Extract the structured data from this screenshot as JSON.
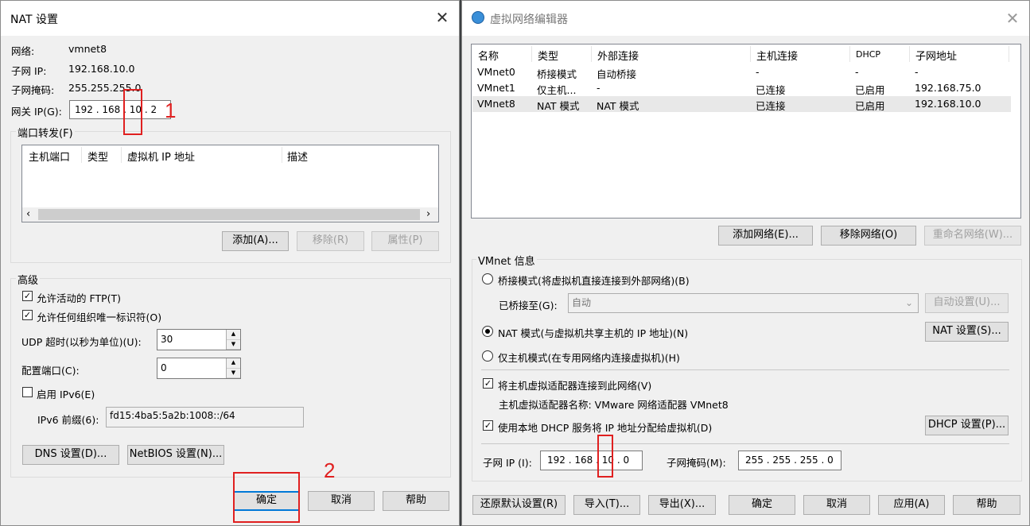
{
  "nat": {
    "title": "NAT 设置",
    "network_label": "网络:",
    "network_value": "vmnet8",
    "subnet_ip_label": "子网 IP:",
    "subnet_ip_value": "192.168.10.0",
    "subnet_mask_label": "子网掩码:",
    "subnet_mask_value": "255.255.255.0",
    "gateway_label": "网关 IP(G):",
    "gateway_octets": [
      "192",
      "168",
      "10",
      "2"
    ],
    "port_forward_label": "端口转发(F)",
    "pf_columns": [
      "主机端口",
      "类型",
      "虚拟机 IP 地址",
      "描述"
    ],
    "add_label": "添加(A)...",
    "remove_label": "移除(R)",
    "props_label": "属性(P)",
    "advanced_label": "高级",
    "allow_ftp_label": "允许活动的 FTP(T)",
    "allow_ftp_checked": true,
    "allow_org_label": "允许任何组织唯一标识符(O)",
    "allow_org_checked": true,
    "udp_label": "UDP 超时(以秒为单位)(U):",
    "udp_value": "30",
    "config_port_label": "配置端口(C):",
    "config_port_value": "0",
    "ipv6_label": "启用 IPv6(E)",
    "ipv6_checked": false,
    "ipv6_prefix_label": "IPv6 前缀(6):",
    "ipv6_prefix_value": "fd15:4ba5:5a2b:1008::/64",
    "dns_label": "DNS 设置(D)...",
    "netbios_label": "NetBIOS 设置(N)...",
    "ok_label": "确定",
    "cancel_label": "取消",
    "help_label": "帮助"
  },
  "vne": {
    "title": "虚拟网络编辑器",
    "columns": [
      "名称",
      "类型",
      "外部连接",
      "主机连接",
      "DHCP",
      "子网地址"
    ],
    "rows": [
      {
        "name": "VMnet0",
        "type": "桥接模式",
        "ext": "自动桥接",
        "host": "-",
        "dhcp": "-",
        "subnet": "-"
      },
      {
        "name": "VMnet1",
        "type": "仅主机...",
        "ext": "-",
        "host": "已连接",
        "dhcp": "已启用",
        "subnet": "192.168.75.0"
      },
      {
        "name": "VMnet8",
        "type": "NAT 模式",
        "ext": "NAT 模式",
        "host": "已连接",
        "dhcp": "已启用",
        "subnet": "192.168.10.0"
      }
    ],
    "add_network": "添加网络(E)...",
    "remove_network": "移除网络(O)",
    "rename_network": "重命名网络(W)...",
    "info_label": "VMnet 信息",
    "bridge_mode": "桥接模式(将虚拟机直接连接到外部网络)(B)",
    "bridged_to_label": "已桥接至(G):",
    "bridged_to_value": "自动",
    "auto_settings": "自动设置(U)...",
    "nat_mode": "NAT 模式(与虚拟机共享主机的 IP 地址)(N)",
    "nat_settings": "NAT 设置(S)...",
    "host_only_mode": "仅主机模式(在专用网络内连接虚拟机)(H)",
    "connect_adapter": "将主机虚拟适配器连接到此网络(V)",
    "connect_adapter_checked": true,
    "adapter_name": "主机虚拟适配器名称: VMware 网络适配器 VMnet8",
    "use_dhcp": "使用本地 DHCP 服务将 IP 地址分配给虚拟机(D)",
    "use_dhcp_checked": true,
    "dhcp_settings": "DHCP 设置(P)...",
    "subnet_ip_label": "子网 IP (I):",
    "subnet_octets": [
      "192",
      "168",
      "10",
      "0"
    ],
    "subnet_mask_label": "子网掩码(M):",
    "mask_octets": [
      "255",
      "255",
      "255",
      "0"
    ],
    "restore_defaults": "还原默认设置(R)",
    "import": "导入(T)...",
    "export": "导出(X)...",
    "ok": "确定",
    "cancel": "取消",
    "apply": "应用(A)",
    "help": "帮助"
  },
  "annotations": {
    "marker1": "1",
    "marker2": "2"
  },
  "colors": {
    "annotation": "#e02020",
    "dialog_bg": "#f0f0f0",
    "accent": "#0078d7"
  }
}
